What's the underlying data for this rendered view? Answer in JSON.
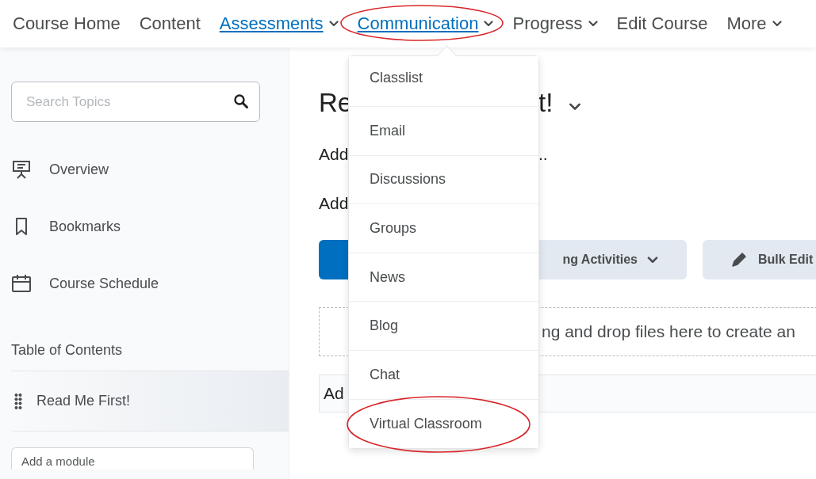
{
  "navbar": {
    "items": [
      {
        "label": "Course Home",
        "link": false,
        "dropdown": false,
        "circled": false
      },
      {
        "label": "Content",
        "link": false,
        "dropdown": false,
        "circled": false
      },
      {
        "label": "Assessments",
        "link": true,
        "dropdown": true,
        "circled": false
      },
      {
        "label": "Communication",
        "link": true,
        "dropdown": true,
        "circled": true
      },
      {
        "label": "Progress",
        "link": false,
        "dropdown": true,
        "circled": false
      },
      {
        "label": "Edit Course",
        "link": false,
        "dropdown": false,
        "circled": false
      },
      {
        "label": "More",
        "link": false,
        "dropdown": true,
        "circled": false
      }
    ]
  },
  "dropdown_menu": {
    "items": [
      {
        "label": "Classlist",
        "circled": false
      },
      {
        "label": "Email",
        "circled": false
      },
      {
        "label": "Discussions",
        "circled": false
      },
      {
        "label": "Groups",
        "circled": false
      },
      {
        "label": "News",
        "circled": false
      },
      {
        "label": "Blog",
        "circled": false
      },
      {
        "label": "Chat",
        "circled": false
      },
      {
        "label": "Virtual Classroom",
        "circled": true
      }
    ]
  },
  "sidebar": {
    "search": {
      "placeholder": "Search Topics"
    },
    "items": [
      {
        "label": "Overview",
        "kind": "overview"
      },
      {
        "label": "Bookmarks",
        "kind": "bookmark"
      },
      {
        "label": "Course Schedule",
        "kind": "calendar"
      }
    ],
    "toc_heading": "Table of Contents",
    "modules": [
      {
        "label": "Read Me First!",
        "selected": true
      }
    ],
    "add_module": {
      "placeholder": "Add a module"
    }
  },
  "main": {
    "title_start": "Re",
    "title_end": "t!",
    "line_1_start": "Add",
    "line_1_end": "..",
    "line_2_start": "Add",
    "buttons": [
      {
        "kind": "primary"
      },
      {
        "label": "ng Activities",
        "kind": "dropdown"
      },
      {
        "label": "Bulk Edit",
        "kind": "edit"
      }
    ],
    "dropzone_text": "ng and drop files here to create an",
    "field_value": "Ad"
  }
}
